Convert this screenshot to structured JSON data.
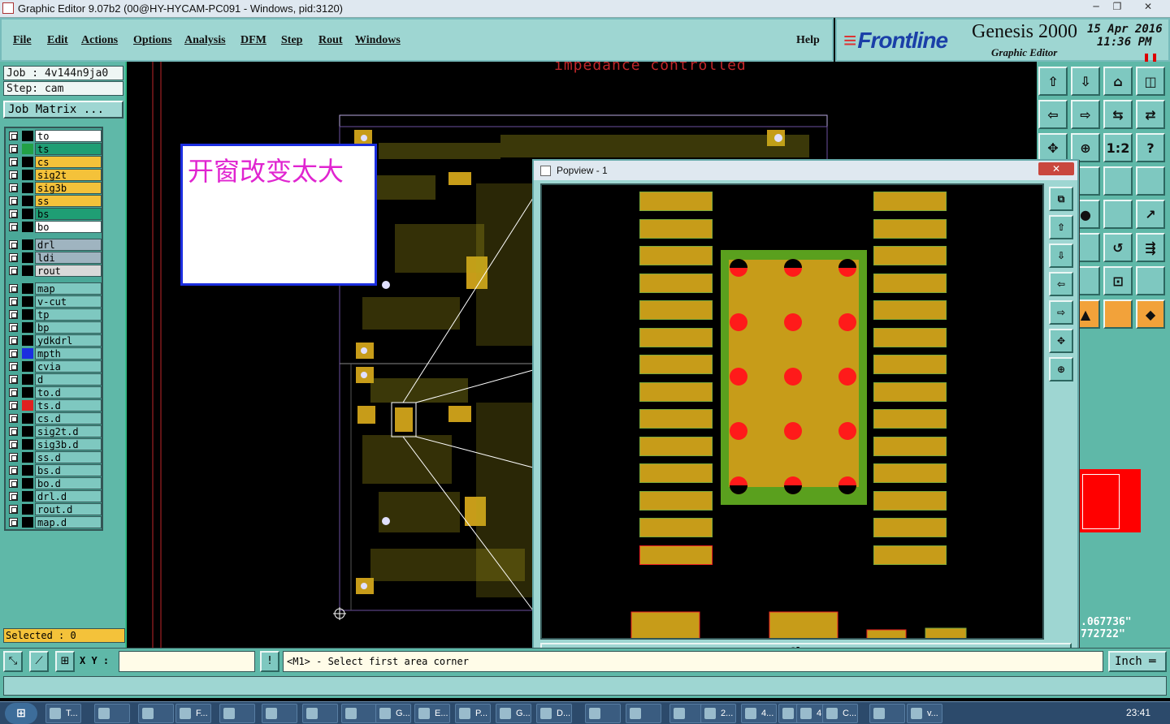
{
  "window": {
    "title": "Graphic Editor 9.07b2 (00@HY-HYCAM-PC091 - Windows, pid:3120)",
    "minimize": "─",
    "maximize": "❐",
    "close": "✕"
  },
  "menu": {
    "items": [
      "File",
      "Edit",
      "Actions",
      "Options",
      "Analysis",
      "DFM",
      "Step",
      "Rout",
      "Windows"
    ],
    "help": "Help"
  },
  "brand": {
    "logo": "Frontline",
    "product": "Genesis 2000",
    "subtitle": "Graphic Editor",
    "date": "15 Apr 2016",
    "time": "11:36 PM"
  },
  "job": {
    "job_line": "Job : 4v144n9ja0",
    "step_line": "Step: cam",
    "matrix_button": "Job Matrix ..."
  },
  "layers": [
    {
      "name": "to",
      "color": "#ffffff",
      "swatch": "#000000"
    },
    {
      "name": "ts",
      "color": "#1f9e74",
      "swatch": "#22a046"
    },
    {
      "name": "cs",
      "color": "#f4c23a",
      "swatch": "#000000"
    },
    {
      "name": "sig2t",
      "color": "#f4c23a",
      "swatch": "#000000"
    },
    {
      "name": "sig3b",
      "color": "#f4c23a",
      "swatch": "#000000"
    },
    {
      "name": "ss",
      "color": "#f4c23a",
      "swatch": "#000000"
    },
    {
      "name": "bs",
      "color": "#1f9e74",
      "swatch": "#000000"
    },
    {
      "name": "bo",
      "color": "#ffffff",
      "swatch": "#000000"
    },
    {
      "name": "drl",
      "color": "#9fb4c0",
      "swatch": "#000000"
    },
    {
      "name": "ldi",
      "color": "#9fb4c0",
      "swatch": "#000000"
    },
    {
      "name": "rout",
      "color": "#d9d9d9",
      "swatch": "#000000"
    },
    {
      "name": "map",
      "color": "#7ec8c0",
      "swatch": "#000000"
    },
    {
      "name": "v-cut",
      "color": "#7ec8c0",
      "swatch": "#000000"
    },
    {
      "name": "tp",
      "color": "#7ec8c0",
      "swatch": "#000000"
    },
    {
      "name": "bp",
      "color": "#7ec8c0",
      "swatch": "#000000"
    },
    {
      "name": "ydkdrl",
      "color": "#7ec8c0",
      "swatch": "#000000"
    },
    {
      "name": "mpth",
      "color": "#7ec8c0",
      "swatch": "#1b2ee0"
    },
    {
      "name": "cvia",
      "color": "#7ec8c0",
      "swatch": "#000000"
    },
    {
      "name": "d",
      "color": "#7ec8c0",
      "swatch": "#000000"
    },
    {
      "name": "to.d",
      "color": "#7ec8c0",
      "swatch": "#000000"
    },
    {
      "name": "ts.d",
      "color": "#7ec8c0",
      "swatch": "#e02020"
    },
    {
      "name": "cs.d",
      "color": "#7ec8c0",
      "swatch": "#000000"
    },
    {
      "name": "sig2t.d",
      "color": "#7ec8c0",
      "swatch": "#000000"
    },
    {
      "name": "sig3b.d",
      "color": "#7ec8c0",
      "swatch": "#000000"
    },
    {
      "name": "ss.d",
      "color": "#7ec8c0",
      "swatch": "#000000"
    },
    {
      "name": "bs.d",
      "color": "#7ec8c0",
      "swatch": "#000000"
    },
    {
      "name": "bo.d",
      "color": "#7ec8c0",
      "swatch": "#000000"
    },
    {
      "name": "drl.d",
      "color": "#7ec8c0",
      "swatch": "#000000"
    },
    {
      "name": "rout.d",
      "color": "#7ec8c0",
      "swatch": "#000000"
    },
    {
      "name": "map.d",
      "color": "#7ec8c0",
      "swatch": "#000000"
    }
  ],
  "selected": "Selected : 0",
  "canvas": {
    "impedance_text": "impedance controlled",
    "note_text": "开窗改变太大"
  },
  "popview": {
    "title": "Popview - 1",
    "close_label": "Close"
  },
  "coords": {
    "x": ".067736\"",
    "y": "772722\""
  },
  "cmd": {
    "xy_label": "X Y :",
    "xy_value": "",
    "prompt": "<M1> - Select first area corner",
    "units": "Inch"
  },
  "taskbar": {
    "start": "⊞",
    "tasks": [
      "T...",
      "",
      "",
      "F...",
      "",
      "",
      "",
      "",
      "G...",
      "E...",
      "P...",
      "G...",
      "D...",
      "",
      "",
      "",
      "2...",
      "4...",
      "",
      "4...",
      "C...",
      "",
      "v..."
    ],
    "clock": "23:41"
  },
  "colors": {
    "panel": "#5fb8a8",
    "menubar": "#9ed6d2",
    "pad_gold": "#c79c19",
    "pad_green": "#5aa01e",
    "drill_red": "#ff1a1a"
  }
}
